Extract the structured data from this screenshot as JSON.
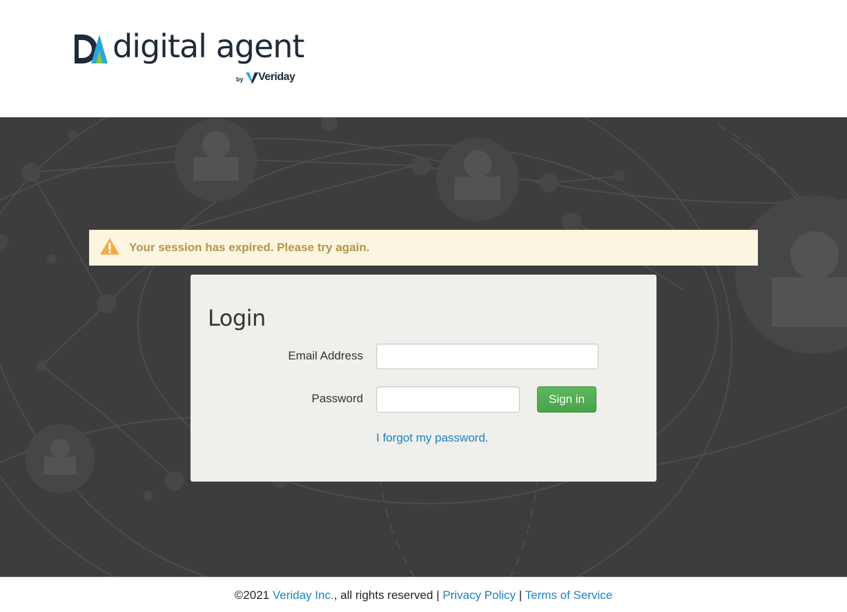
{
  "brand": {
    "name": "digital agent",
    "by": "by",
    "company": "Veriday"
  },
  "alert": {
    "message": "Your session has expired. Please try again."
  },
  "login": {
    "title": "Login",
    "email_label": "Email Address",
    "email_value": "",
    "password_label": "Password",
    "password_value": "",
    "signin_label": "Sign in",
    "forgot_link": "I forgot my password."
  },
  "footer": {
    "copyright": "©2021",
    "company_link": "Veriday Inc.",
    "rights": ", all rights reserved",
    "sep1": "|",
    "privacy_link": "Privacy Policy",
    "sep2": "|",
    "terms_link": "Terms of Service"
  },
  "colors": {
    "accent_blue": "#1a82c4",
    "button_green": "#5cb85c",
    "alert_bg": "#fcf6e1",
    "alert_text": "#b7944a",
    "stage_bg": "#3d3d3d"
  }
}
